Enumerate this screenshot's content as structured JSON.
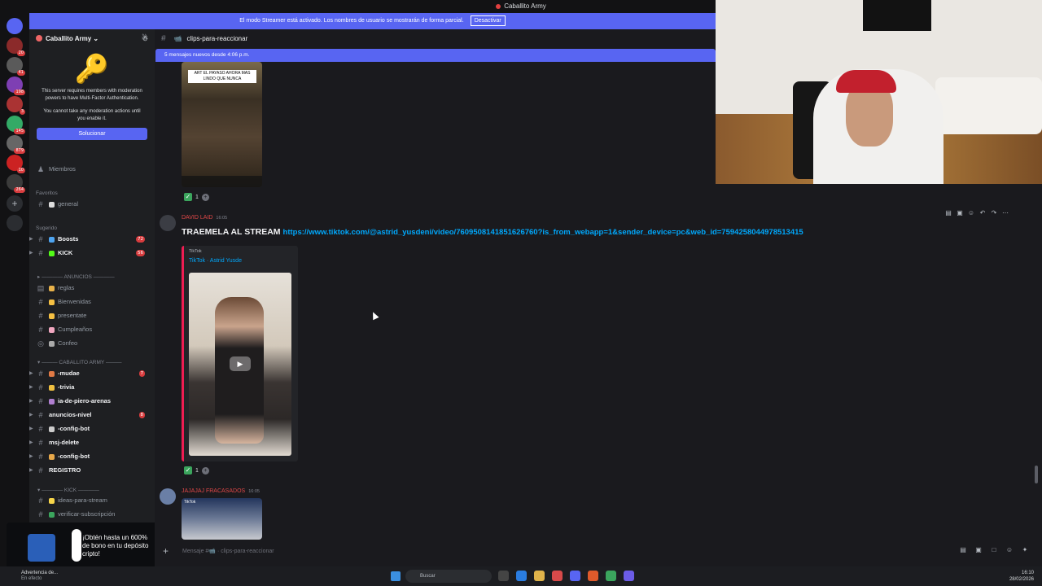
{
  "window": {
    "title": "Caballito Army"
  },
  "banner": {
    "text": "El modo Streamer está activado. Los nombres de usuario se mostrarán de forma parcial.",
    "button": "Desactivar"
  },
  "server_rail": {
    "badges": [
      "20",
      "41",
      "198",
      "3",
      "145",
      "879",
      "10",
      "264"
    ]
  },
  "guild": {
    "name": "Caballito Army ⌄",
    "mfa_text": "This server requires members with moderation powers to have Multi-Factor Authentication.",
    "mfa_sub": "You cannot take any moderation actions until you enable it.",
    "fix_button": "Solucionar",
    "members": "Miembros",
    "favorites_header": "Favoritos",
    "suggested_header": "Sugerido"
  },
  "channels": [
    {
      "name": "general",
      "bold": false
    },
    {
      "name": "Boosts",
      "bold": true,
      "count": "72"
    },
    {
      "name": "KICK",
      "bold": true,
      "count": "56"
    },
    {
      "name": "reglas",
      "bold": false
    },
    {
      "name": "Bienvenidas",
      "bold": false
    },
    {
      "name": "presentate",
      "bold": false
    },
    {
      "name": "Cumpleaños",
      "bold": false
    },
    {
      "name": "Confeo",
      "bold": false
    },
    {
      "name": "-mudae",
      "bold": true,
      "count": "7"
    },
    {
      "name": "-trivia",
      "bold": true
    },
    {
      "name": "ia-de-piero-arenas",
      "bold": true
    },
    {
      "name": "anuncios-nivel",
      "bold": true,
      "count": "8"
    },
    {
      "name": "-config-bot",
      "bold": true
    },
    {
      "name": "msj-delete",
      "bold": true
    },
    {
      "name": "-config-bot",
      "bold": true
    },
    {
      "name": "REGISTRO",
      "bold": true
    },
    {
      "name": "ideas-para-stream",
      "bold": false
    },
    {
      "name": "verificar-subscripción",
      "bold": false
    }
  ],
  "categories": {
    "anuncios": "ANUNCIOS",
    "caballito": "CABALLITO ARMY",
    "kick": "KICK"
  },
  "promo": {
    "text": "¡Obtén hasta un 600% de bono en tu depósito cripto!"
  },
  "channel_header": {
    "name": "clips-para-reaccionar"
  },
  "new_messages": "5 mensajes nuevos desde 4:06 p.m.",
  "clip1": {
    "caption": "ART EL PAYASO AHORA MAS LINDO QUE NUNCA"
  },
  "reactions": {
    "count1": "1",
    "count2": "1"
  },
  "message1": {
    "author": "DAVID LAID",
    "time": "16:05",
    "text": "TRAEMELA AL STREAM",
    "link": "https://www.tiktok.com/@astrid_yusdeni/video/7609508141851626760?is_from_webapp=1&sender_device=pc&web_id=7594258044978513415",
    "embed_provider": "TikTok",
    "embed_title": "TikTok · Astrid Yusde"
  },
  "message2": {
    "author": "JAJAJAJ FRACASADOS",
    "time": "16:05",
    "thumb_label": "TikTok"
  },
  "composer": {
    "placeholder": "Mensaje #📹 · clips-para-reaccionar"
  },
  "taskbar": {
    "warning": "Advertencia de...",
    "warning_sub": "En efecto",
    "search": "Buscar",
    "time": "16:10",
    "date": "28/02/2026"
  }
}
